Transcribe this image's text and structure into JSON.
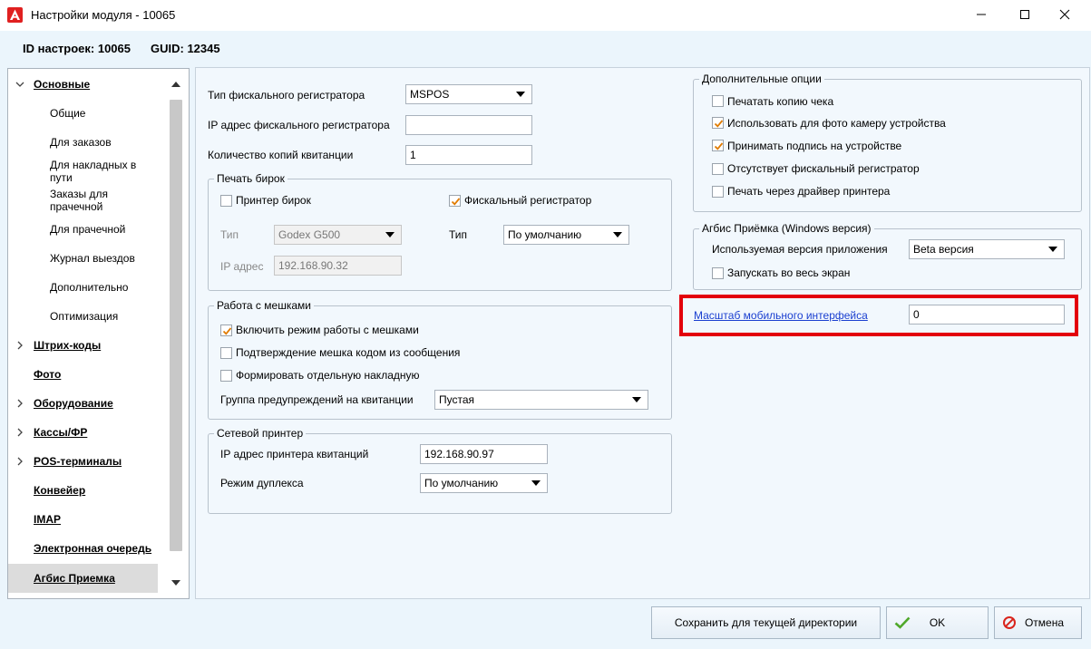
{
  "window": {
    "title": "Настройки модуля  - 10065",
    "minimize_icon": "minimize-icon",
    "maximize_icon": "maximize-icon",
    "close_icon": "close-icon"
  },
  "header": {
    "settings_id": "ID настроек: 10065",
    "guid": "GUID: 12345"
  },
  "sidebar": {
    "items": [
      {
        "label": "Основные",
        "level": 0,
        "expanded": true
      },
      {
        "label": "Общие",
        "level": 1
      },
      {
        "label": "Для заказов",
        "level": 1
      },
      {
        "label": "Для накладных в пути",
        "level": 1
      },
      {
        "label": "Заказы для прачечной",
        "level": 1
      },
      {
        "label": "Для прачечной",
        "level": 1
      },
      {
        "label": "Журнал выездов",
        "level": 1
      },
      {
        "label": "Дополнительно",
        "level": 1
      },
      {
        "label": "Оптимизация",
        "level": 1
      },
      {
        "label": "Штрих-коды",
        "level": 0,
        "expandable": true
      },
      {
        "label": "Фото",
        "level": 0
      },
      {
        "label": "Оборудование",
        "level": 0,
        "expandable": true
      },
      {
        "label": "Кассы/ФР",
        "level": 0,
        "expandable": true
      },
      {
        "label": "POS-терминалы",
        "level": 0,
        "expandable": true
      },
      {
        "label": "Конвейер",
        "level": 0
      },
      {
        "label": "IMAP",
        "level": 0
      },
      {
        "label": "Электронная очередь",
        "level": 0
      },
      {
        "label": "Агбис Приемка",
        "level": 0,
        "selected": true
      }
    ]
  },
  "fiscal": {
    "type_label": "Тип фискального регистратора",
    "type_value": "MSPOS",
    "ip_label": "IP адрес фискального регистратора",
    "ip_value": "",
    "copies_label": "Количество копий квитанции",
    "copies_value": "1"
  },
  "tags_print": {
    "title": "Печать бирок",
    "tag_printer_label": "Принтер бирок",
    "tag_printer_checked": false,
    "fiscal_label": "Фискальный регистратор",
    "fiscal_checked": true,
    "type_label_left": "Тип",
    "type_value_left": "Godex G500",
    "type_label_right": "Тип",
    "type_value_right": "По умолчанию",
    "ip_label": "IP адрес",
    "ip_value": "192.168.90.32"
  },
  "bags": {
    "title": "Работа с мешками",
    "enable_label": "Включить режим работы с мешками",
    "enable_checked": true,
    "confirm_label": "Подтверждение мешка кодом из сообщения",
    "confirm_checked": false,
    "separate_label": "Формировать отдельную накладную",
    "separate_checked": false,
    "warn_group_label": "Группа предупреждений на квитанции",
    "warn_group_value": "Пустая"
  },
  "net_printer": {
    "title": "Сетевой принтер",
    "ip_label": "IP адрес принтера квитанций",
    "ip_value": "192.168.90.97",
    "duplex_label": "Режим дуплекса",
    "duplex_value": "По умолчанию"
  },
  "extra": {
    "title": "Дополнительные опции",
    "options": [
      {
        "label": "Печатать копию чека",
        "checked": false
      },
      {
        "label": "Использовать для фото камеру устройства",
        "checked": true
      },
      {
        "label": "Принимать подпись на устройстве",
        "checked": true
      },
      {
        "label": "Отсутствует фискальный регистратор",
        "checked": false
      },
      {
        "label": "Печать через драйвер принтера",
        "checked": false
      }
    ]
  },
  "agbis": {
    "title": "Агбис Приёмка (Windows версия)",
    "version_label": "Используемая версия приложения",
    "version_value": "Beta версия",
    "fullscreen_label": "Запускать во весь экран",
    "fullscreen_checked": false
  },
  "mobile_scale": {
    "label": "Масштаб мобильного интерфейса",
    "value": "0"
  },
  "buttons": {
    "save_dir": "Сохранить для текущей директории",
    "ok": "OK",
    "cancel": "Отмена"
  },
  "colors": {
    "accent_check": "#e07b00",
    "highlight_border": "#e3000b",
    "link": "#1a3fd0",
    "window_bg": "#ebf5fc"
  }
}
